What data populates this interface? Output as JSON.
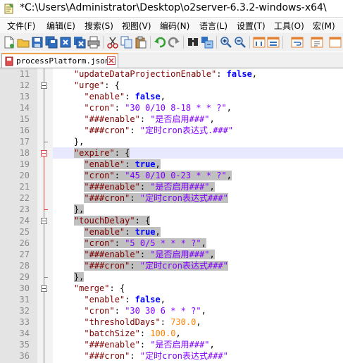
{
  "window": {
    "title": "*C:\\Users\\Administrator\\Desktop\\o2server-6.3.2-windows-x64\\"
  },
  "menu": [
    {
      "label": "文件(F)"
    },
    {
      "label": "编辑(E)"
    },
    {
      "label": "搜索(S)"
    },
    {
      "label": "视图(V)"
    },
    {
      "label": "编码(N)"
    },
    {
      "label": "语言(L)"
    },
    {
      "label": "设置(T)"
    },
    {
      "label": "工具(O)"
    },
    {
      "label": "宏(M)"
    }
  ],
  "toolbar": {
    "icons": [
      "new-file-icon",
      "open-file-icon",
      "save-icon",
      "save-all-icon",
      "close-icon",
      "close-all-icon",
      "print-icon",
      "cut-icon",
      "copy-icon",
      "paste-icon",
      "undo-icon",
      "redo-icon",
      "find-icon",
      "replace-icon",
      "zoom-in-icon",
      "zoom-out-icon",
      "sync-vertical-icon",
      "sync-horizontal-icon"
    ]
  },
  "tab": {
    "label": "processPlatform.json"
  },
  "colors": {
    "key": "#800000",
    "string": "#8000ff",
    "bool": "#0000ff",
    "number": "#ff8000",
    "selection": "#c0c0c0",
    "gutter": "#e4e4e4"
  },
  "lines": [
    {
      "n": "11",
      "text": "    \"updateDataProjectionEnable\": false,"
    },
    {
      "n": "12",
      "text": "    \"urge\": {"
    },
    {
      "n": "13",
      "text": "      \"enable\": false,"
    },
    {
      "n": "14",
      "text": "      \"cron\": \"30 0/10 8-18 * * ?\","
    },
    {
      "n": "15",
      "text": "      \"###enable\": \"是否启用###\","
    },
    {
      "n": "16",
      "text": "      \"###cron\": \"定时cron表达式.###\""
    },
    {
      "n": "17",
      "text": "    },"
    },
    {
      "n": "18",
      "text": "    \"expire\": {"
    },
    {
      "n": "19",
      "text": "      \"enable\": true,"
    },
    {
      "n": "20",
      "text": "      \"cron\": \"45 0/10 0-23 * * ?\","
    },
    {
      "n": "21",
      "text": "      \"###enable\": \"是否启用###\","
    },
    {
      "n": "22",
      "text": "      \"###cron\": \"定时cron表达式###\""
    },
    {
      "n": "23",
      "text": "    },"
    },
    {
      "n": "24",
      "text": "    \"touchDelay\": {"
    },
    {
      "n": "25",
      "text": "      \"enable\": true,"
    },
    {
      "n": "26",
      "text": "      \"cron\": \"5 0/5 * * * ?\","
    },
    {
      "n": "27",
      "text": "      \"###enable\": \"是否启用###\","
    },
    {
      "n": "28",
      "text": "      \"###cron\": \"定时cron表达式###\""
    },
    {
      "n": "29",
      "text": "    },"
    },
    {
      "n": "30",
      "text": "    \"merge\": {"
    },
    {
      "n": "31",
      "text": "      \"enable\": false,"
    },
    {
      "n": "32",
      "text": "      \"cron\": \"30 30 6 * * ?\","
    },
    {
      "n": "33",
      "text": "      \"thresholdDays\": 730.0,"
    },
    {
      "n": "34",
      "text": "      \"batchSize\": 100.0,"
    },
    {
      "n": "35",
      "text": "      \"###enable\": \"是否启用###\","
    },
    {
      "n": "36",
      "text": "      \"###cron\": \"定时cron表达式###\""
    }
  ]
}
